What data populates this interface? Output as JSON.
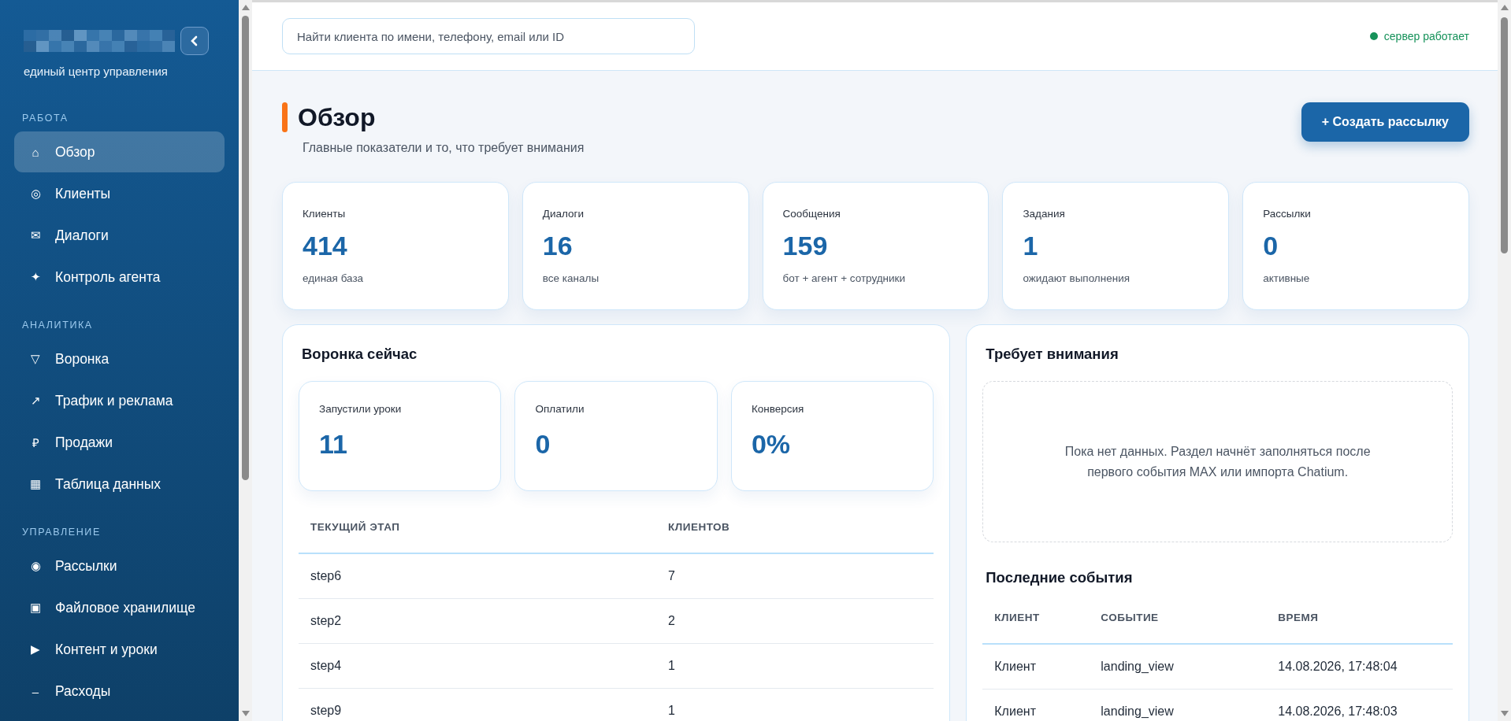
{
  "sidebar": {
    "subtitle": "единый центр управления",
    "sections": [
      {
        "title": "РАБОТА",
        "items": [
          {
            "icon": "⌂",
            "label": "Обзор",
            "selected": true
          },
          {
            "icon": "◎",
            "label": "Клиенты",
            "selected": false
          },
          {
            "icon": "✉",
            "label": "Диалоги",
            "selected": false
          },
          {
            "icon": "✦",
            "label": "Контроль агента",
            "selected": false
          }
        ]
      },
      {
        "title": "АНАЛИТИКА",
        "items": [
          {
            "icon": "▽",
            "label": "Воронка",
            "selected": false
          },
          {
            "icon": "↗",
            "label": "Трафик и реклама",
            "selected": false
          },
          {
            "icon": "₽",
            "label": "Продажи",
            "selected": false
          },
          {
            "icon": "▦",
            "label": "Таблица данных",
            "selected": false
          }
        ]
      },
      {
        "title": "УПРАВЛЕНИЕ",
        "items": [
          {
            "icon": "◉",
            "label": "Рассылки",
            "selected": false
          },
          {
            "icon": "▣",
            "label": "Файловое хранилище",
            "selected": false
          },
          {
            "icon": "▶",
            "label": "Контент и уроки",
            "selected": false
          },
          {
            "icon": "–",
            "label": "Расходы",
            "selected": false
          }
        ]
      }
    ]
  },
  "header": {
    "search": {
      "placeholder": "Найти клиента по имени, телефону, email или ID"
    },
    "status": {
      "text": "сервер работает",
      "online": true
    }
  },
  "page": {
    "title": "Обзор",
    "subtitle": "Главные показатели и то, что требует внимания",
    "action_button": "+ Создать рассылку"
  },
  "stats": [
    {
      "label": "Клиенты",
      "value": "414",
      "note": "единая база"
    },
    {
      "label": "Диалоги",
      "value": "16",
      "note": "все каналы"
    },
    {
      "label": "Сообщения",
      "value": "159",
      "note": "бот + агент + сотрудники"
    },
    {
      "label": "Задания",
      "value": "1",
      "note": "ожидают выполнения"
    },
    {
      "label": "Рассылки",
      "value": "0",
      "note": "активные"
    }
  ],
  "funnel": {
    "title": "Воронка сейчас",
    "metrics": [
      {
        "label": "Запустили уроки",
        "value": "11"
      },
      {
        "label": "Оплатили",
        "value": "0"
      },
      {
        "label": "Конверсия",
        "value": "0%"
      }
    ],
    "table": {
      "columns": [
        "ТЕКУЩИЙ ЭТАП",
        "КЛИЕНТОВ"
      ],
      "rows": [
        [
          "step6",
          "7"
        ],
        [
          "step2",
          "2"
        ],
        [
          "step4",
          "1"
        ],
        [
          "step9",
          "1"
        ]
      ]
    }
  },
  "attention": {
    "title": "Требует внимания",
    "empty_text": "Пока нет данных. Раздел начнёт заполняться после первого события MAX или импорта Chatium."
  },
  "events": {
    "title": "Последние события",
    "table": {
      "columns": [
        "КЛИЕНТ",
        "СОБЫТИЕ",
        "ВРЕМЯ"
      ],
      "rows": [
        [
          "Клиент",
          "landing_view",
          "14.08.2026, 17:48:04"
        ],
        [
          "Клиент",
          "landing_view",
          "14.08.2026, 17:48:03"
        ]
      ]
    }
  }
}
